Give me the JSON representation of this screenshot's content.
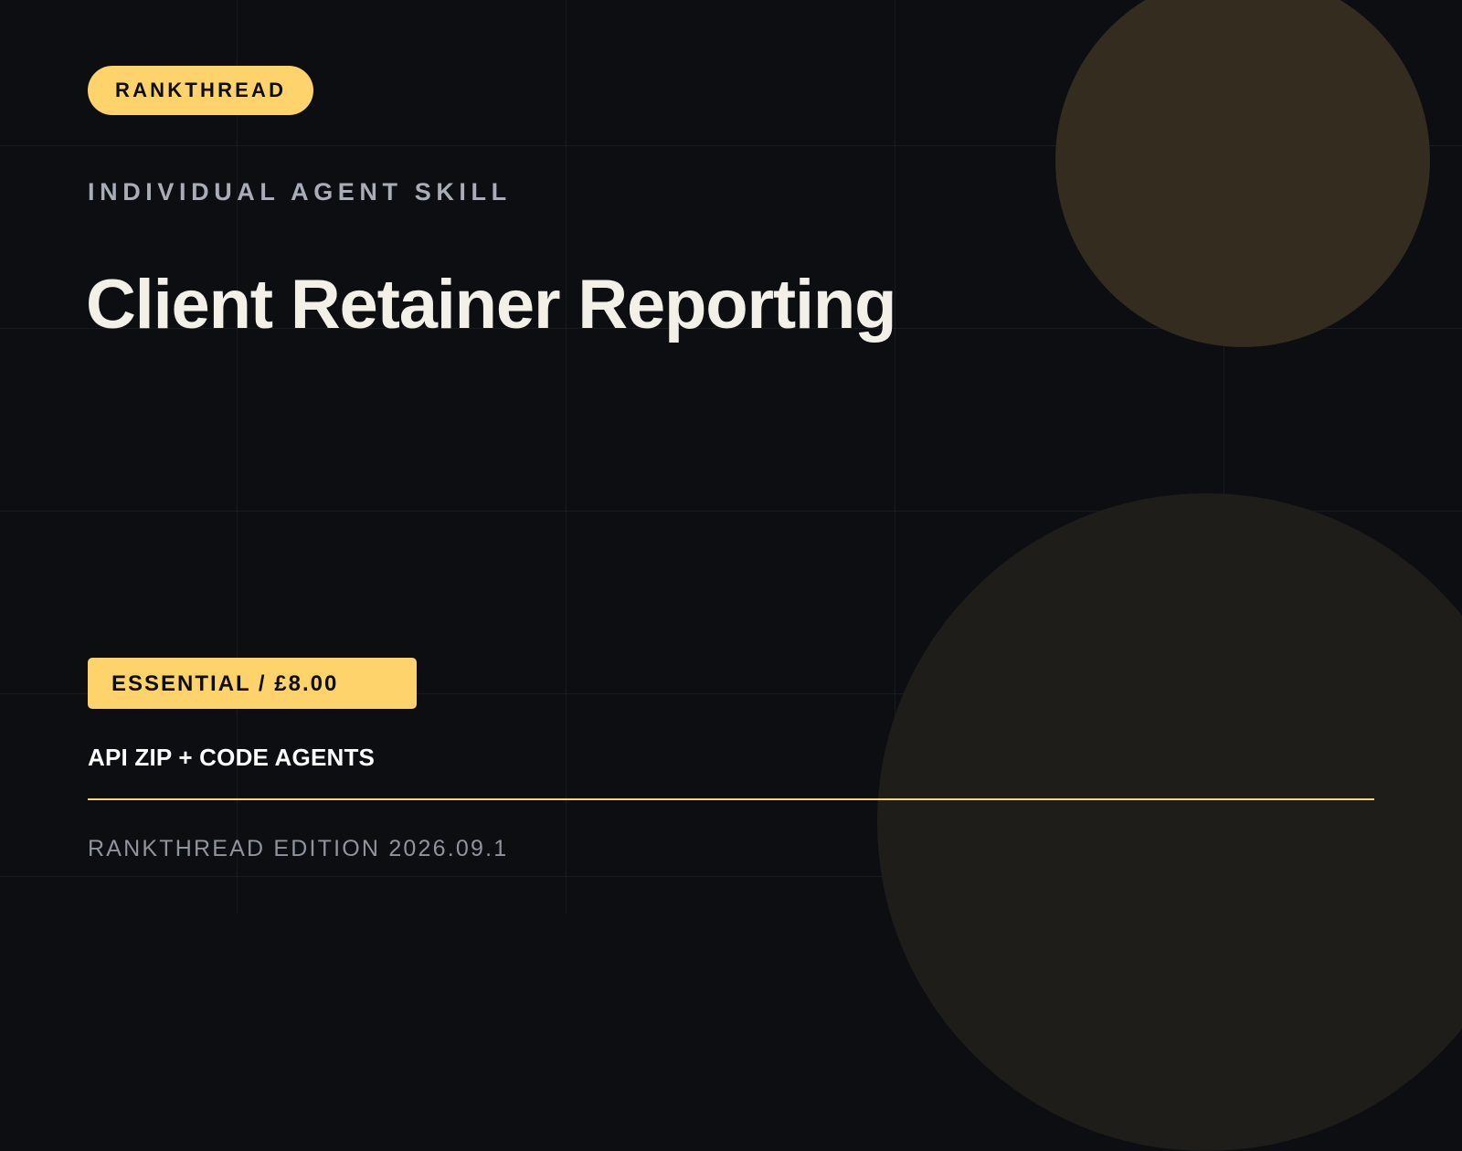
{
  "brand": {
    "label": "RANKTHREAD"
  },
  "eyebrow": "INDIVIDUAL AGENT SKILL",
  "title": "Client Retainer Reporting",
  "price_badge": "ESSENTIAL / £8.00",
  "delivery": "API ZIP + CODE AGENTS",
  "edition": "RANKTHREAD EDITION 2026.09.1",
  "colors": {
    "background": "#0c0e12",
    "accent": "#ffd36b",
    "title": "#f3f0e8",
    "muted": "#a8adb8"
  }
}
